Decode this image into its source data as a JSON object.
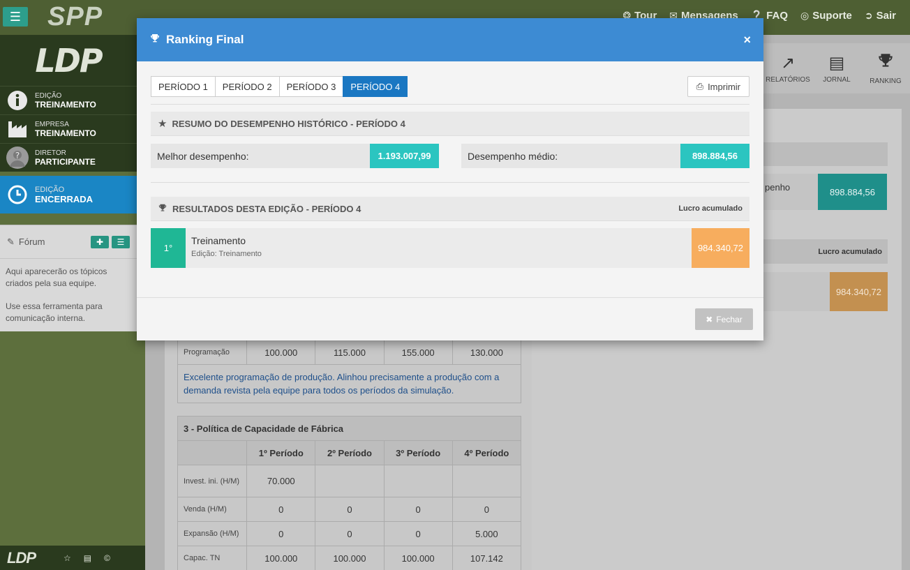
{
  "navbar": {
    "brand": "SPP",
    "links": [
      {
        "label": "Tour",
        "icon": "compass-icon"
      },
      {
        "label": "Mensagens",
        "icon": "envelope-icon"
      },
      {
        "label": "FAQ",
        "icon": "question-icon"
      },
      {
        "label": "Suporte",
        "icon": "lifebuoy-icon"
      },
      {
        "label": "Sair",
        "icon": "sign-out-icon"
      }
    ]
  },
  "sidebar": {
    "logo": "LDP",
    "items": [
      {
        "label": "EDIÇÃO",
        "value": "TREINAMENTO"
      },
      {
        "label": "EMPRESA",
        "value": "TREINAMENTO"
      },
      {
        "label": "DIRETOR",
        "value": "PARTICIPANTE"
      }
    ],
    "status": {
      "label": "EDIÇÃO",
      "value": "ENCERRADA"
    },
    "forum": {
      "title": "Fórum",
      "text1": "Aqui aparecerão os tópicos criados pela sua equipe.",
      "text2": "Use essa ferramenta para comunicação interna."
    },
    "footer_logo": "LDP"
  },
  "toolbar": {
    "items": [
      {
        "label": "RELATÓRIOS",
        "icon": "chart-icon"
      },
      {
        "label": "JORNAL",
        "icon": "newspaper-icon"
      },
      {
        "label": "RANKING",
        "icon": "trophy-icon"
      }
    ]
  },
  "background": {
    "right_label": "penho",
    "right_value1": "898.884,56",
    "right_header": "Lucro acumulado",
    "right_value2": "984.340,72",
    "table1": {
      "row_label": "Programação",
      "values": [
        "100.000",
        "115.000",
        "155.000",
        "130.000"
      ],
      "note": "Excelente programação de produção. Alinhou precisamente a produção com a demanda revista pela equipe para todos os períodos da simulação."
    },
    "table2": {
      "title": "3 - Política de Capacidade de Fábrica",
      "headers": [
        "1º Período",
        "2º Período",
        "3º Período",
        "4º Período"
      ],
      "rows": [
        {
          "label": "Invest. ini. (H/M)",
          "values": [
            "70.000",
            "",
            "",
            ""
          ]
        },
        {
          "label": "Venda (H/M)",
          "values": [
            "0",
            "0",
            "0",
            "0"
          ]
        },
        {
          "label": "Expansão (H/M)",
          "values": [
            "0",
            "0",
            "0",
            "5.000"
          ]
        },
        {
          "label": "Capac. TN",
          "values": [
            "100.000",
            "100.000",
            "100.000",
            "107.142"
          ]
        }
      ]
    }
  },
  "modal": {
    "title": "Ranking Final",
    "close_symbol": "×",
    "tabs": [
      "PERÍODO 1",
      "PERÍODO 2",
      "PERÍODO 3",
      "PERÍODO 4"
    ],
    "active_tab": 3,
    "print_label": "Imprimir",
    "summary": {
      "title": "RESUMO DO DESEMPENHO HISTÓRICO - PERÍODO 4",
      "best_label": "Melhor desempenho:",
      "best_value": "1.193.007,99",
      "avg_label": "Desempenho médio:",
      "avg_value": "898.884,56"
    },
    "results": {
      "title": "RESULTADOS DESTA EDIÇÃO - PERÍODO 4",
      "column_label": "Lucro acumulado",
      "rows": [
        {
          "rank": "1°",
          "team": "Treinamento",
          "edition": "Edição: Treinamento",
          "profit": "984.340,72"
        }
      ]
    },
    "close_label": "Fechar"
  },
  "colors": {
    "modal_header": "#3d8bd3",
    "active_tab": "#1a77c2",
    "stat_value": "#2bc5c0",
    "rank_badge": "#1fb795",
    "profit": "#f7ad5e",
    "status_blue": "#1a86c5"
  }
}
